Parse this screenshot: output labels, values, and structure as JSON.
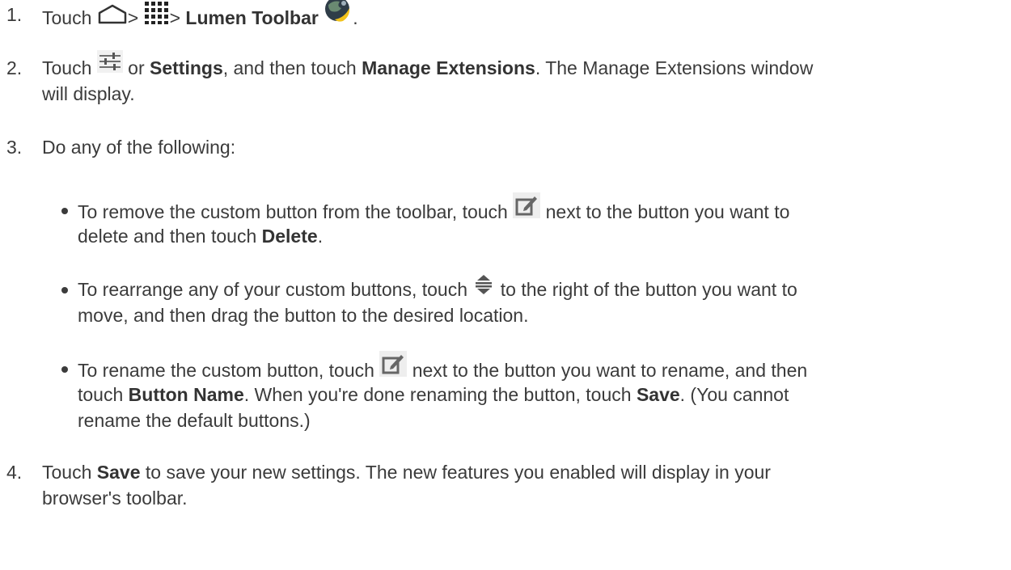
{
  "steps": [
    {
      "num": "1.",
      "parts": {
        "a": "Touch",
        "b": ">",
        "c": ">",
        "d": "Lumen Toolbar",
        "e": "."
      }
    },
    {
      "num": "2.",
      "parts": {
        "a": "Touch",
        "b": "or",
        "c": "Settings",
        "d": ", and then touch",
        "e": "Manage Extensions",
        "f": ". The Manage Extensions window",
        "g": "will display."
      }
    },
    {
      "num": "3.",
      "text": "Do any of the following:"
    },
    {
      "num": "4.",
      "parts": {
        "a": "Touch",
        "b": "Save",
        "c": "to save your new settings. The new features you enabled will display in your",
        "d": "browser's toolbar."
      }
    }
  ],
  "bullets": [
    {
      "l1a": "To remove the custom button from the toolbar, touch",
      "l1b": "next to the button you want to",
      "l2a": "delete and then touch",
      "l2b": "Delete",
      "l2c": "."
    },
    {
      "l1a": "To rearrange any of your custom buttons, touch",
      "l1b": "to the right of the button you want to",
      "l2": "move, and then drag the button to the desired location."
    },
    {
      "l1a": "To rename the custom button, touch",
      "l1b": "next to the button you want to rename, and then",
      "l2a": "touch",
      "l2b": "Button Name",
      "l2c": ". When you're done renaming the button, touch",
      "l2d": "Save",
      "l2e": ". (You cannot",
      "l3": "rename the default buttons.)"
    }
  ],
  "icons": [
    "home-icon",
    "apps-grid-icon",
    "lumen-toolbar-icon",
    "settings-sliders-icon",
    "edit-icon",
    "reorder-icon",
    "edit-icon"
  ]
}
